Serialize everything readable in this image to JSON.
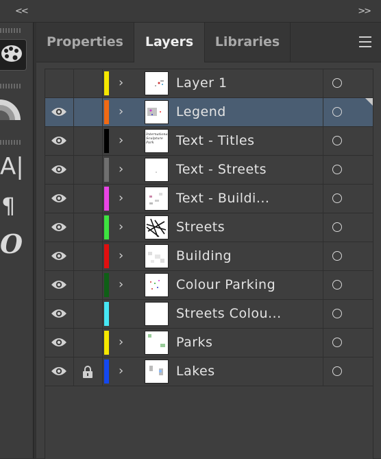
{
  "topbar": {
    "collapse_left": "<<",
    "collapse_right": ">>"
  },
  "tools": {
    "icons": [
      "palette-icon",
      "color-guide-icon",
      "character-icon",
      "paragraph-icon",
      "opentype-icon"
    ],
    "character_glyph": "A|",
    "paragraph_glyph": "¶",
    "opentype_glyph": "O"
  },
  "tabs": [
    {
      "label": "Properties",
      "active": false
    },
    {
      "label": "Layers",
      "active": true
    },
    {
      "label": "Libraries",
      "active": false
    }
  ],
  "layers": [
    {
      "name": "Layer 1",
      "color": "#f5e700",
      "visible": false,
      "locked": false,
      "expandable": true,
      "selected": false,
      "thumb_text": ""
    },
    {
      "name": "Legend",
      "color": "#f06a14",
      "visible": true,
      "locked": false,
      "expandable": true,
      "selected": true,
      "thumb_text": ""
    },
    {
      "name": "Text - Titles",
      "color": "#000000",
      "visible": true,
      "locked": false,
      "expandable": true,
      "selected": false,
      "thumb_text": "International Sculpture Park"
    },
    {
      "name": "Text - Streets",
      "color": "#6f6f6f",
      "visible": true,
      "locked": false,
      "expandable": true,
      "selected": false,
      "thumb_text": ""
    },
    {
      "name": "Text - Buildi...",
      "color": "#e944e5",
      "visible": true,
      "locked": false,
      "expandable": true,
      "selected": false,
      "thumb_text": ""
    },
    {
      "name": "Streets",
      "color": "#3de33f",
      "visible": true,
      "locked": false,
      "expandable": true,
      "selected": false,
      "thumb_text": ""
    },
    {
      "name": "Building",
      "color": "#e00f0f",
      "visible": true,
      "locked": false,
      "expandable": true,
      "selected": false,
      "thumb_text": ""
    },
    {
      "name": "Colour Parking",
      "color": "#0f5f16",
      "visible": true,
      "locked": false,
      "expandable": true,
      "selected": false,
      "thumb_text": ""
    },
    {
      "name": "Streets Colou...",
      "color": "#46e6f4",
      "visible": true,
      "locked": false,
      "expandable": false,
      "selected": false,
      "thumb_text": ""
    },
    {
      "name": "Parks",
      "color": "#f5e700",
      "visible": true,
      "locked": false,
      "expandable": true,
      "selected": false,
      "thumb_text": ""
    },
    {
      "name": "Lakes",
      "color": "#1348f0",
      "visible": true,
      "locked": true,
      "expandable": true,
      "selected": false,
      "thumb_text": ""
    }
  ],
  "glyphs": {
    "expand": "›"
  }
}
